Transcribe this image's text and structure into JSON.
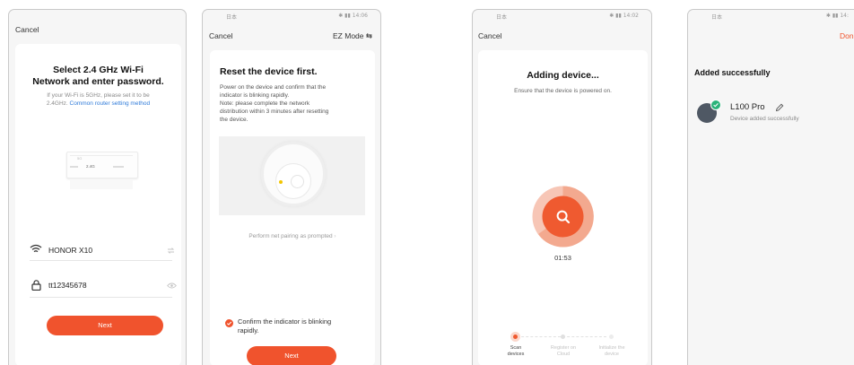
{
  "screen1": {
    "cancel": "Cancel",
    "title_line1": "Select 2.4 GHz Wi-Fi",
    "title_line2": "Network and enter password.",
    "hint_line1": "If your Wi-Fi is 5GHz, please set it to be",
    "hint_line2_prefix": "2.4GHz. ",
    "hint_link": "Common router setting method",
    "router_items": [
      "5G",
      "2.4G"
    ],
    "wifi_name": "HONOR X10",
    "password": "tt12345678",
    "next": "Next"
  },
  "screen2": {
    "status_left": "日本",
    "status_right": "✱ ▮▮ 14:06",
    "cancel": "Cancel",
    "mode": "EZ Mode ⇆",
    "title": "Reset the device first.",
    "desc_line1": "Power on the device and confirm that the",
    "desc_line2": "indicator is blinking rapidly.",
    "note_line1": "Note: please complete the network",
    "note_line2": "distribution within 3 minutes after resetting",
    "note_line3": "the device.",
    "pairing_link": "Perform net pairing as prompted",
    "confirm_line1": "Confirm the indicator is blinking",
    "confirm_line2": "rapidly.",
    "next": "Next"
  },
  "screen3": {
    "status_left": "日本",
    "status_right": "✱ ▮▮ 14:02",
    "cancel": "Cancel",
    "title": "Adding device...",
    "subtitle": "Ensure that the device is powered on.",
    "timer": "01:53",
    "steps": [
      {
        "line1": "Scan",
        "line2": "devices"
      },
      {
        "line1": "Register on",
        "line2": "Cloud"
      },
      {
        "line1": "Initialize the",
        "line2": "device"
      }
    ]
  },
  "screen4": {
    "status_left": "日本",
    "status_right": "✱ ▮▮ 14:",
    "done": "Don",
    "title": "Added successfully",
    "device_name": "L100 Pro",
    "device_status": "Device added successfully"
  },
  "colors": {
    "accent": "#f0532d",
    "link": "#2f7bd9",
    "success": "#2ab37a"
  }
}
